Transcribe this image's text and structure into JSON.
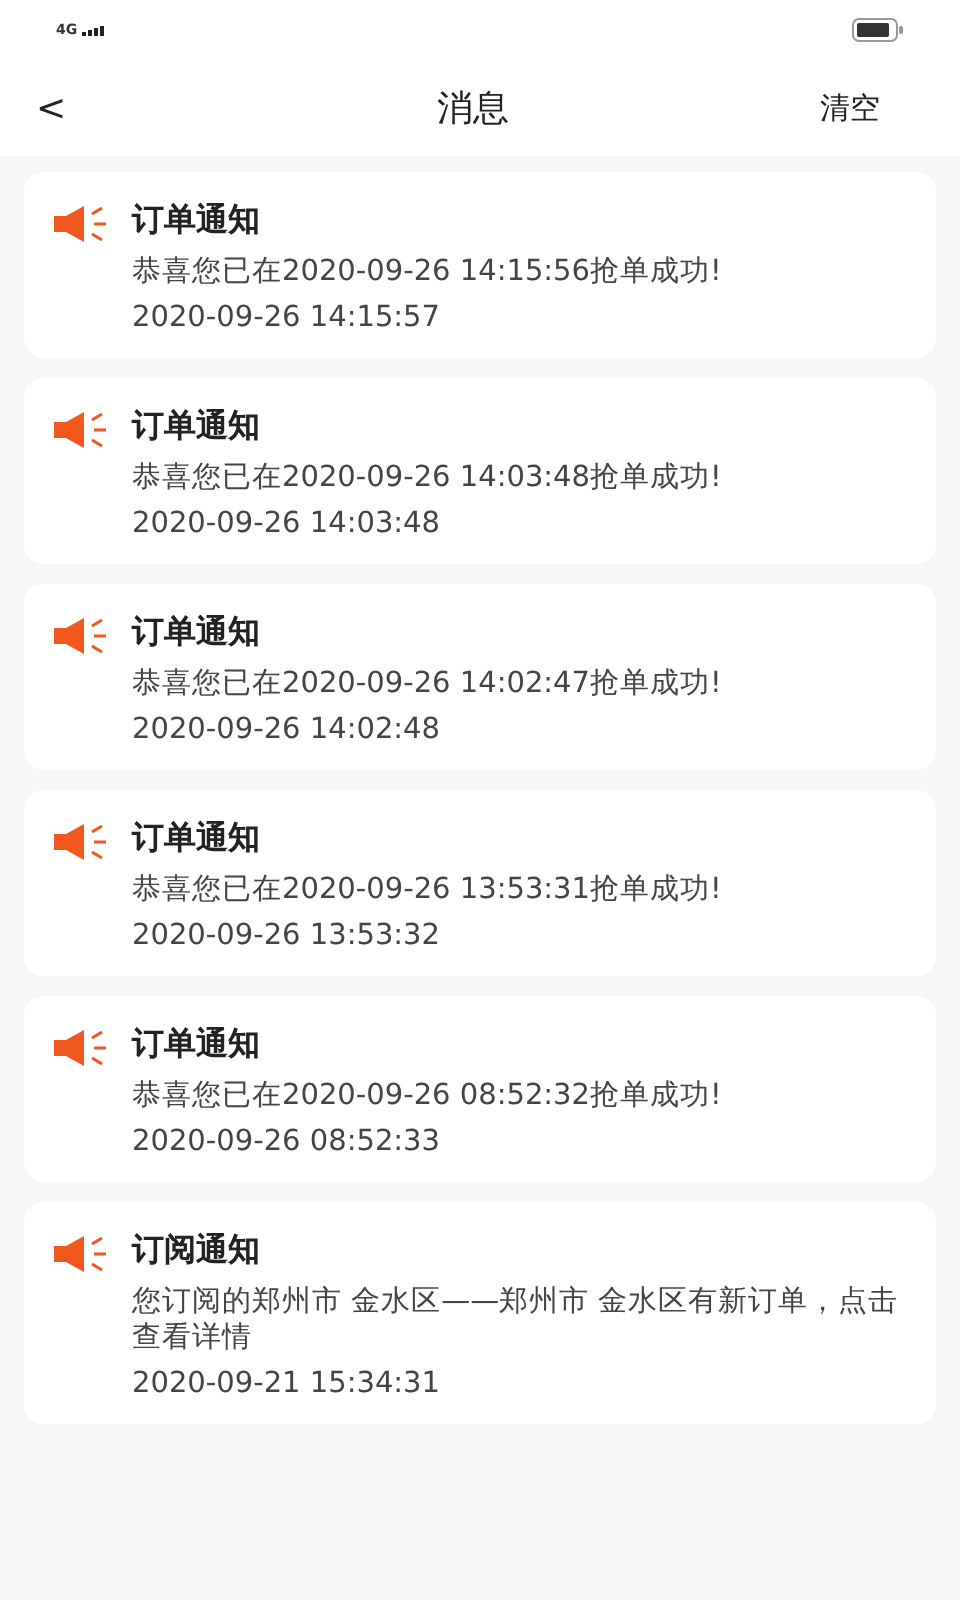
{
  "status_bar": {
    "network": "4G"
  },
  "header": {
    "back": "<",
    "title": "消息",
    "action": "清空"
  },
  "messages": [
    {
      "title": "订单通知",
      "body": "恭喜您已在2020-09-26 14:15:56抢单成功!",
      "time": "2020-09-26 14:15:57"
    },
    {
      "title": "订单通知",
      "body": "恭喜您已在2020-09-26 14:03:48抢单成功!",
      "time": "2020-09-26 14:03:48"
    },
    {
      "title": "订单通知",
      "body": "恭喜您已在2020-09-26 14:02:47抢单成功!",
      "time": "2020-09-26 14:02:48"
    },
    {
      "title": "订单通知",
      "body": "恭喜您已在2020-09-26 13:53:31抢单成功!",
      "time": "2020-09-26 13:53:32"
    },
    {
      "title": "订单通知",
      "body": "恭喜您已在2020-09-26 08:52:32抢单成功!",
      "time": "2020-09-26 08:52:33"
    },
    {
      "title": "订阅通知",
      "body": "您订阅的郑州市 金水区——郑州市 金水区有新订单，点击查看详情",
      "time": "2020-09-21 15:34:31"
    }
  ]
}
